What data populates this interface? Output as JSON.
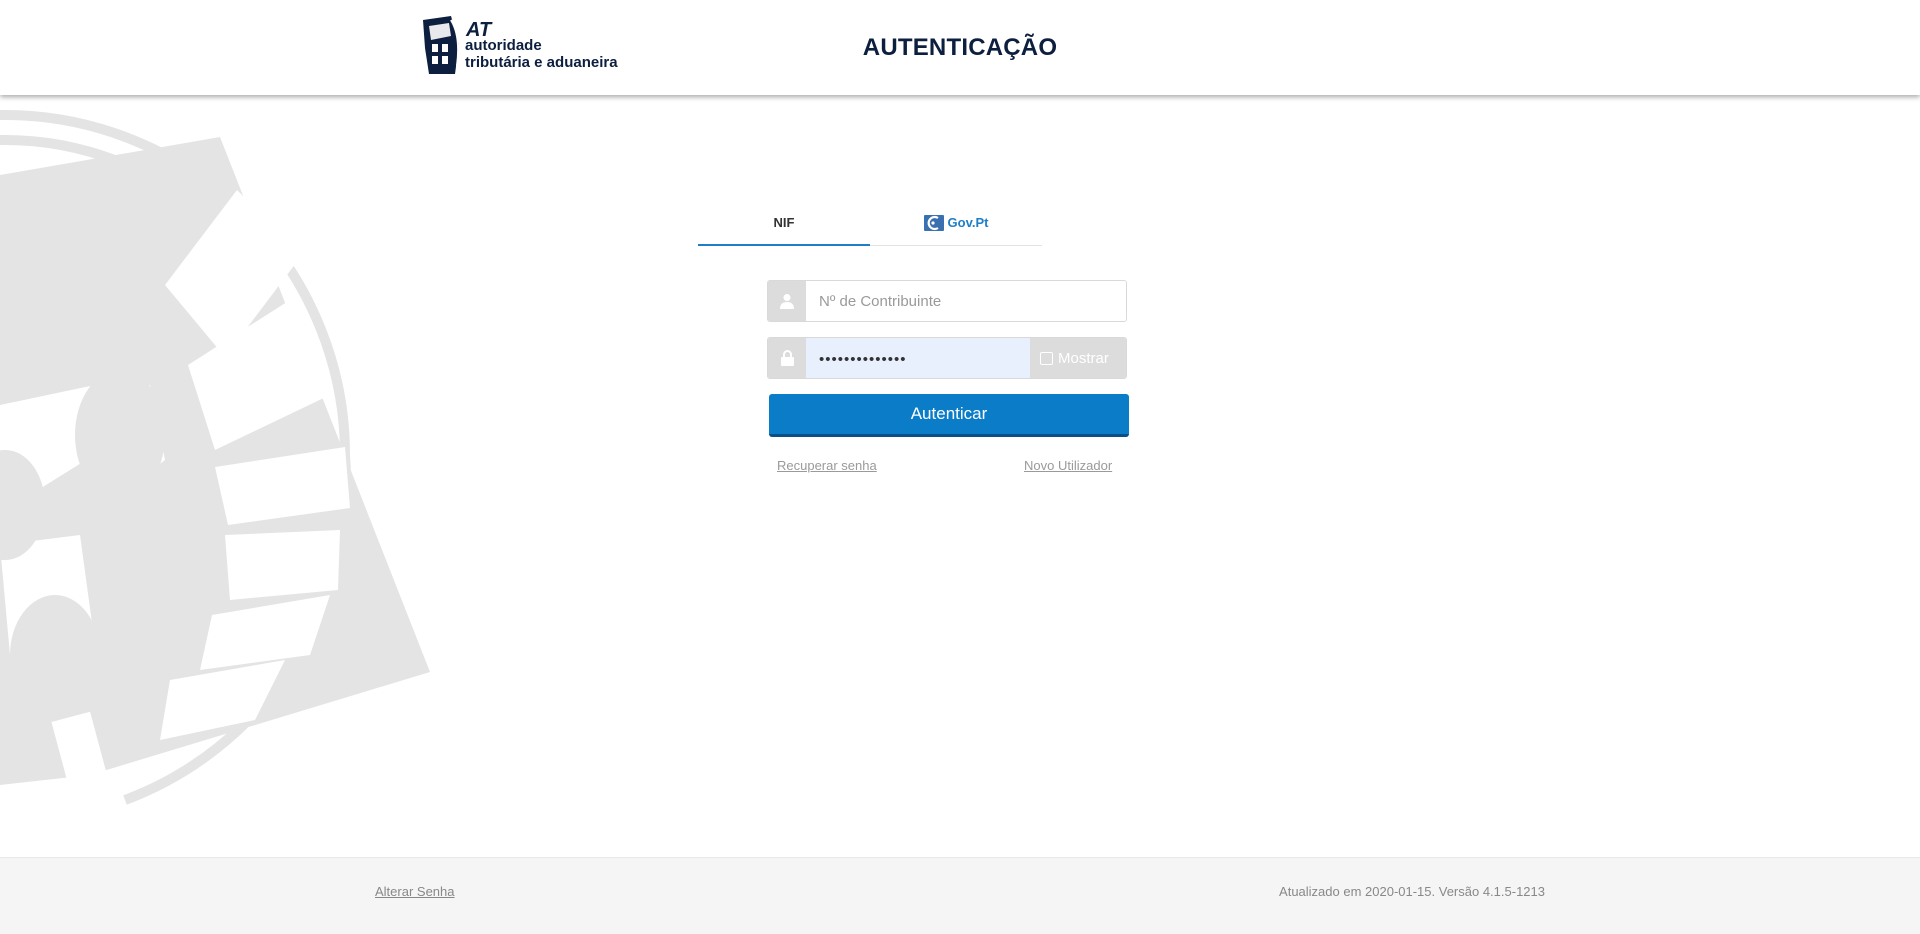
{
  "header": {
    "logo": {
      "at": "AT",
      "line1": "autoridade",
      "line2": "tributária e aduaneira"
    },
    "title": "AUTENTICAÇÃO"
  },
  "tabs": [
    {
      "label": "NIF",
      "active": true
    },
    {
      "label": "Gov.Pt",
      "active": false,
      "icon": "gov-pt-icon"
    }
  ],
  "form": {
    "nif": {
      "placeholder": "Nº de Contribuinte",
      "value": "",
      "icon": "user-icon"
    },
    "password": {
      "value": "••••••••••••••",
      "icon": "lock-icon",
      "show_label": "Mostrar"
    },
    "submit_label": "Autenticar",
    "links": {
      "recover": "Recuperar senha",
      "new_user": "Novo Utilizador"
    }
  },
  "footer": {
    "change_password": "Alterar Senha",
    "version": "Atualizado em 2020-01-15. Versão 4.1.5-1213"
  },
  "colors": {
    "brand_navy": "#0d1f3f",
    "accent_blue": "#0a7cc8",
    "autofill_bg": "#e8f0fe",
    "addon_gray": "#dcdcdc"
  }
}
